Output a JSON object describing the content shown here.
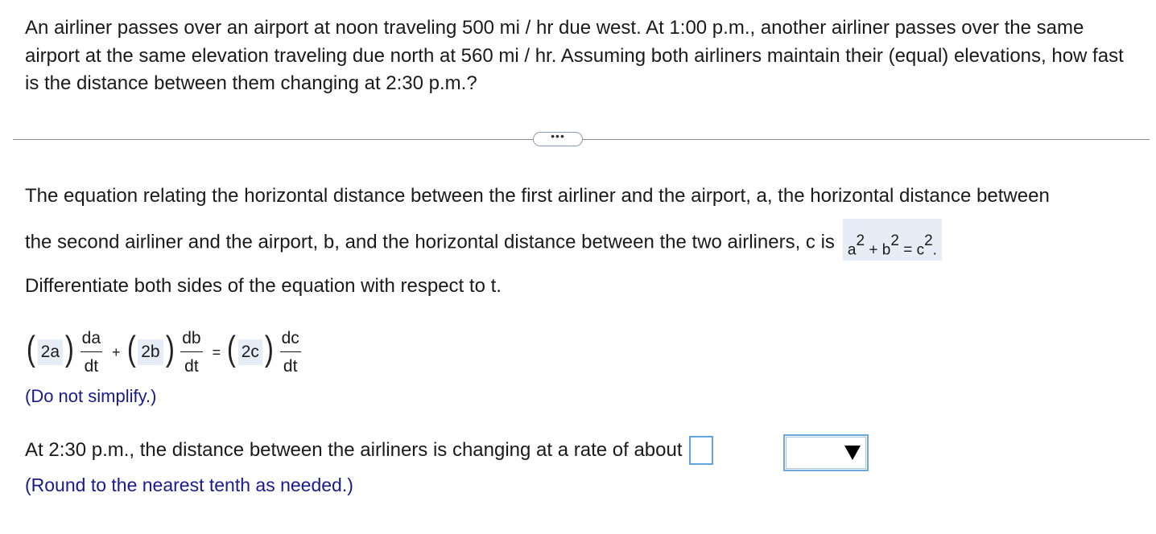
{
  "question": {
    "text": "An airliner passes over an airport at noon traveling 500 mi / hr due west. At 1:00 p.m., another airliner passes over the same airport at the same elevation traveling due north at 560 mi / hr. Assuming both airliners maintain their (equal) elevations, how fast is the distance between them changing at 2:30 p.m.?"
  },
  "more_button": {
    "label": "•••"
  },
  "step1": {
    "line1": "The equation relating the horizontal distance between the first airliner and the airport, a, the horizontal distance between",
    "line2": "the second airliner and the airport, b, and the horizontal distance between the two airliners, c is",
    "equation": {
      "a": "a",
      "b": "b",
      "c": "c",
      "exp": "2",
      "plus": "+",
      "equals": "=",
      "period": "."
    }
  },
  "step2": {
    "instruction": "Differentiate both sides of the equation with respect to t.",
    "coef_a": "2a",
    "coef_b": "2b",
    "coef_c": "2c",
    "da": "da",
    "db": "db",
    "dc": "dc",
    "dt": "dt",
    "plus": "+",
    "equals": "=",
    "hint": "(Do not simplify.)"
  },
  "step3": {
    "prompt": "At 2:30 p.m., the distance between the airliners is changing at a rate of about",
    "answer_value": "",
    "units_selected": "",
    "hint": "(Round to the nearest tenth as needed.)"
  }
}
